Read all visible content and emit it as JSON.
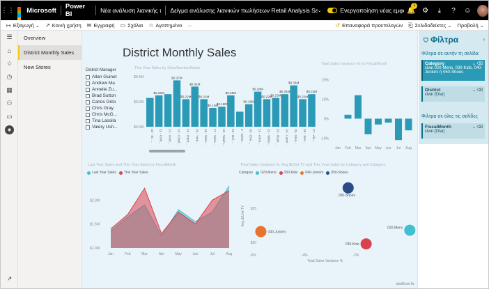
{
  "topbar": {
    "brand": "Microsoft",
    "app": "Power BI",
    "workspace": "Νέα ανάλυση λιανικής πώλησης",
    "report": "Δείγμα ανάλυσης λιανικών πωλήσεων Retail Analysis Sample-new-filtersRetail",
    "toggle_label": "Ενεργοποίηση νέας εμφάνισης",
    "notif_count": "1"
  },
  "cmdbar": {
    "export": "Εξαγωγή",
    "share": "Κοινή χρήση",
    "subscribe": "Εγγραφή",
    "comments": "Σχόλια",
    "favorite": "Αγαπημένο",
    "more": "···",
    "reset": "Επαναφορά προεπιλογών",
    "bookmarks": "Σελιδοδείκτες",
    "view": "Προβολή"
  },
  "pages": [
    "Overview",
    "District Monthly Sales",
    "New Stores"
  ],
  "report": {
    "title": "District Monthly Sales",
    "slicer_title": "District Manager",
    "managers": [
      "Allan Guinot",
      "Andrew Ma",
      "Annelie Zu...",
      "Brad Sutton",
      "Carlos Grilo",
      "Chris Gray",
      "Chris McG...",
      "Tina Lassila",
      "Valery Ush..."
    ],
    "bar_title": "This Year Sales by StoreNumberName",
    "var_title": "Total Sales Variance % by FiscalMonth",
    "area_title": "Last Year Sales and This Year Sales by FiscalMonth",
    "area_legend": [
      "Last Year Sales",
      "This Year Sales"
    ],
    "scatter_title": "Total Sales Variance %, Avg $/Unit TY and This Year Sales by Category and Category",
    "scatter_legend_label": "Category",
    "scatter_legend": [
      "020-Mens",
      "030-Kids",
      "040-Juniors",
      "050-Shoes"
    ],
    "scatter_xlabel": "Total Sales Variance %",
    "scatter_ylabel": "Avg $/Unit TY",
    "footer": "obviEnce llc"
  },
  "filters": {
    "title": "Φίλτρα",
    "on_page": "Φίλτρα σε αυτήν τη σελίδα",
    "on_all": "Φίλτρα σε όλες τις σελίδες",
    "card1_title": "Category",
    "card1_value": "είναι 020-Mens, 030-Kids, 040-Juniors ή 050-Shoes",
    "card2_title": "District",
    "card2_value": "είναι (Όλα)",
    "card3_title": "FiscalMonth",
    "card3_value": "είναι (Όλα)"
  },
  "colors": {
    "teal": "#2b9ab6",
    "red": "#d9434e",
    "cyan": "#3fbfcf",
    "orange": "#e8722e",
    "navy": "#2a4c89",
    "canvas": "#e9f4fa",
    "brand": "#f2c811"
  },
  "chart_data": [
    {
      "type": "bar",
      "title": "This Year Sales by StoreNumberName",
      "categories": [
        "10 - St. ...",
        "11 - Cent...",
        "12 - Kent...",
        "13 - Charl...",
        "14 - Harri...",
        "15 - York...",
        "16 - Winc...",
        "17 - Wich...",
        "18 - Wash...",
        "19 - Bel ...",
        "2 - Weirt...",
        "20 - Erie ...",
        "21 - Ashe...",
        "22 - Wilso...",
        "23 - Bowl...",
        "24 - Lexin...",
        "25 - Mon...",
        "26 - Ster...",
        "27 - Ale..."
      ],
      "values": [
        0.23,
        0.25,
        0.26,
        0.37,
        0.22,
        0.32,
        0.22,
        0.15,
        0.16,
        0.25,
        0.12,
        0.18,
        0.28,
        0.22,
        0.23,
        0.26,
        0.33,
        0.22,
        0.26
      ],
      "labels": [
        "",
        "$0.25M",
        "",
        "$0.37M",
        "$0.22M",
        "$0.32M",
        "$0.22M",
        "$0.15M",
        "$0.16M",
        "$0.25M",
        "",
        "$0.18M",
        "$0.28M",
        "$0.22M",
        "$0.23M",
        "$0.26M",
        "$0.33M",
        "$0.22M",
        "$0.23M"
      ],
      "ylim": [
        0,
        0.4
      ],
      "yticks": [
        "$0.0M",
        "$0.2M",
        "$0.4M"
      ]
    },
    {
      "type": "bar",
      "title": "Total Sales Variance % by FiscalMonth",
      "categories": [
        "Jan",
        "Feb",
        "Mar",
        "Apr",
        "May",
        "Jun",
        "Jul",
        "Aug"
      ],
      "values": [
        0,
        2,
        12,
        -8,
        -3,
        -2,
        -11,
        -6
      ],
      "ylim": [
        -12,
        23
      ],
      "yticks": [
        "20%",
        "10%",
        "0%",
        "-10%"
      ]
    },
    {
      "type": "area",
      "title": "Last Year Sales and This Year Sales by FiscalMonth",
      "categories": [
        "Jan",
        "Feb",
        "Mar",
        "Apr",
        "May",
        "Jun",
        "Jul",
        "Aug"
      ],
      "series": [
        {
          "name": "Last Year Sales",
          "values": [
            1.35,
            1.65,
            1.9,
            1.25,
            1.8,
            1.55,
            1.75,
            2.3
          ]
        },
        {
          "name": "This Year Sales",
          "values": [
            1.4,
            1.7,
            2.25,
            1.3,
            1.75,
            1.5,
            2.0,
            2.2
          ]
        }
      ],
      "ylim": [
        1.0,
        2.4
      ],
      "yticks": [
        "$2.0M",
        "$1.5M",
        "$1.0M"
      ]
    },
    {
      "type": "scatter",
      "title": "Total Sales Variance %, Avg $/Unit TY and This Year Sales by Category and Category",
      "xlabel": "Total Sales Variance %",
      "ylabel": "Avg $/Unit TY",
      "points": [
        {
          "name": "050-Shoes",
          "x": -2.3,
          "y": 28
        },
        {
          "name": "040-Juniors",
          "x": -5.7,
          "y": 21.6
        },
        {
          "name": "020-Mens",
          "x": 0.1,
          "y": 21.8
        },
        {
          "name": "030-Kids",
          "x": -1.6,
          "y": 19.8
        }
      ],
      "xlim": [
        -6.2,
        0.2
      ],
      "ylim": [
        18.8,
        29
      ],
      "xticks": [
        "-6%",
        "-4%",
        "-2%"
      ],
      "yticks": [
        "$25",
        "$20"
      ]
    }
  ]
}
